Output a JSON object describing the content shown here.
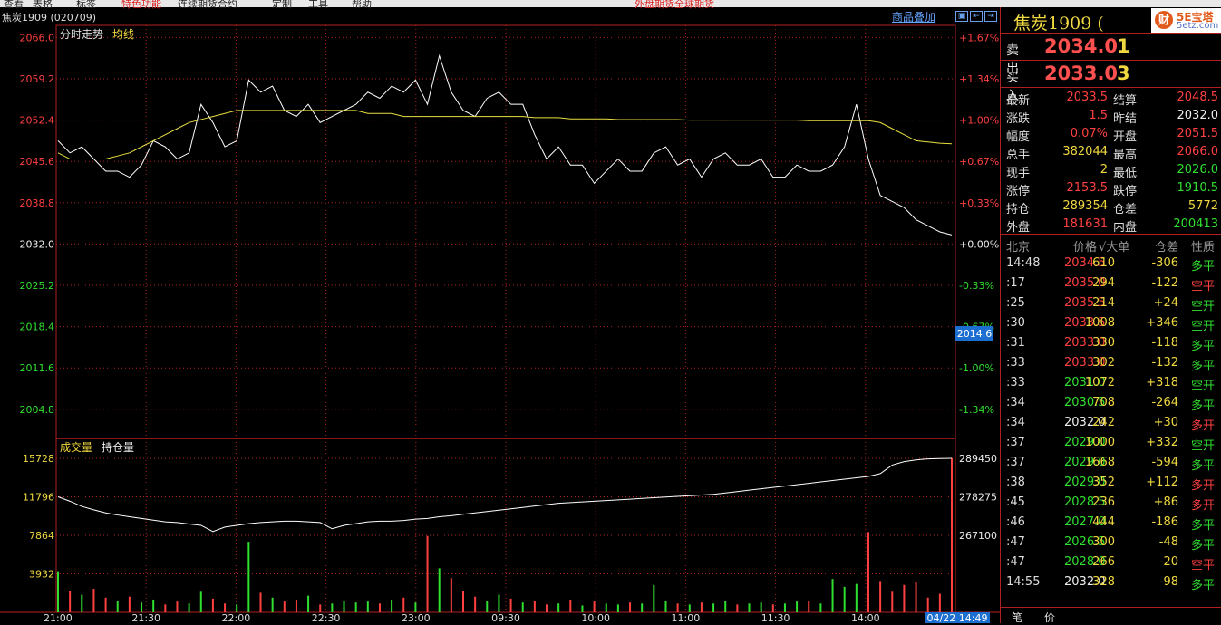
{
  "menu": {
    "items": [
      {
        "label": "查看",
        "color": "dark"
      },
      {
        "label": "表格",
        "color": "dark"
      },
      {
        "label": "标签",
        "color": "dark"
      },
      {
        "label": "特色功能",
        "color": "red"
      },
      {
        "label": "连续期货合约",
        "color": "dark"
      },
      {
        "label": "定制",
        "color": "dark"
      },
      {
        "label": "工具",
        "color": "dark"
      },
      {
        "label": "帮助",
        "color": "dark"
      },
      {
        "label": "外盘期货全球期货",
        "color": "red"
      }
    ]
  },
  "chart_header": {
    "symbol": "焦炭1909 (020709)",
    "overlay_link": "商品叠加",
    "nav_buttons": [
      "▣",
      "⇤",
      "⇥",
      "□"
    ]
  },
  "price_panel": {
    "title": "分时走势",
    "avg_label": "均线",
    "price_ticks": [
      "2066.0",
      "2059.2",
      "2052.4",
      "2045.6",
      "2038.8",
      "2032.0",
      "2025.2",
      "2018.4",
      "2011.6",
      "2004.8"
    ],
    "pct_ticks": [
      "+1.67%",
      "+1.34%",
      "+1.00%",
      "+0.67%",
      "+0.33%",
      "+0.00%",
      "-0.33%",
      "-0.67%",
      "-1.00%",
      "-1.34%"
    ],
    "cursor_value": "2014.6"
  },
  "volume_panel": {
    "vol_label": "成交量",
    "oi_label": "持仓量",
    "vol_ticks": [
      "15728",
      "11796",
      "7864",
      "3932"
    ],
    "oi_ticks": [
      "289450",
      "278275",
      "267100"
    ]
  },
  "time_axis": {
    "labels": [
      "21:00",
      "21:30",
      "22:00",
      "22:30",
      "23:00",
      "09:30",
      "10:00",
      "11:00",
      "11:30",
      "14:00",
      "14:30"
    ],
    "cursor_time": "04/22 14:49"
  },
  "chart_data": {
    "type": "line",
    "ylim": [
      2000.0,
      2068.0
    ],
    "ref_price": 2032.0,
    "price": [
      2049,
      2047,
      2048,
      2046,
      2044,
      2044,
      2043,
      2045,
      2049,
      2048,
      2046,
      2047,
      2055,
      2052,
      2048,
      2049,
      2059,
      2057,
      2058,
      2054,
      2053,
      2055,
      2052,
      2053,
      2054,
      2055,
      2057,
      2056,
      2058,
      2057,
      2059,
      2055,
      2063,
      2057,
      2054,
      2053,
      2056,
      2057,
      2055,
      2055,
      2050,
      2046,
      2048,
      2045,
      2045,
      2042,
      2044,
      2046,
      2044,
      2044,
      2047,
      2048,
      2045,
      2046,
      2043,
      2046,
      2047,
      2045,
      2045,
      2046,
      2043,
      2043,
      2045,
      2044,
      2044,
      2045,
      2048,
      2055,
      2046,
      2040,
      2039,
      2038,
      2036,
      2035,
      2034,
      2033.5
    ],
    "avg": [
      2047,
      2046,
      2046,
      2046,
      2046,
      2046.5,
      2047,
      2048,
      2049,
      2050,
      2051,
      2052,
      2052.5,
      2053,
      2053.5,
      2054,
      2054,
      2054,
      2054,
      2054,
      2054,
      2054,
      2054,
      2054,
      2054,
      2054,
      2053.5,
      2053.5,
      2053.5,
      2053,
      2053,
      2053,
      2053,
      2053,
      2053,
      2053,
      2053,
      2053,
      2053,
      2053,
      2052.8,
      2052.8,
      2052.8,
      2052.6,
      2052.6,
      2052.6,
      2052.6,
      2052.5,
      2052.5,
      2052.5,
      2052.5,
      2052.5,
      2052.5,
      2052.4,
      2052.4,
      2052.4,
      2052.4,
      2052.4,
      2052.4,
      2052.4,
      2052.4,
      2052.4,
      2052.4,
      2052.3,
      2052.3,
      2052.3,
      2052.3,
      2052.3,
      2052.3,
      2052,
      2051,
      2050,
      2049,
      2048.8,
      2048.6,
      2048.5
    ],
    "oi": [
      278275,
      277000,
      275500,
      274500,
      273600,
      273000,
      272500,
      272000,
      271500,
      271000,
      270800,
      270400,
      270000,
      268200,
      269500,
      270000,
      270500,
      270800,
      271000,
      271200,
      271200,
      271000,
      270800,
      269000,
      270000,
      270500,
      271000,
      271200,
      271200,
      271400,
      271800,
      272000,
      272500,
      272800,
      273200,
      273600,
      274000,
      274400,
      274800,
      275200,
      275600,
      276000,
      276400,
      276600,
      276800,
      277000,
      277200,
      277400,
      277600,
      277800,
      278000,
      278200,
      278400,
      278600,
      278800,
      279000,
      279400,
      279800,
      280200,
      280600,
      281000,
      281400,
      281800,
      282200,
      282600,
      283000,
      283400,
      283800,
      284200,
      285000,
      287500,
      288500,
      289000,
      289300,
      289400,
      289450
    ],
    "volume": [
      4200,
      2200,
      1800,
      2400,
      1500,
      1200,
      1600,
      1000,
      1300,
      800,
      1100,
      900,
      2100,
      1400,
      900,
      800,
      7200,
      2000,
      1500,
      1100,
      1300,
      1700,
      800,
      900,
      1200,
      1000,
      1100,
      900,
      1300,
      1500,
      1000,
      7800,
      4500,
      3500,
      2200,
      1600,
      1200,
      1800,
      1400,
      1000,
      1200,
      800,
      900,
      1300,
      700,
      1100,
      900,
      800,
      1000,
      900,
      2800,
      1200,
      900,
      800,
      1000,
      900,
      1200,
      800,
      900,
      1000,
      800,
      900,
      1100,
      1200,
      900,
      3400,
      2600,
      2900,
      8200,
      3200,
      2100,
      2800,
      3100,
      1500,
      1900,
      15728
    ],
    "series": [
      {
        "name": "均线"
      },
      {
        "name": "成交量"
      },
      {
        "name": "持仓量"
      }
    ]
  },
  "quote": {
    "name": "焦炭1909 (",
    "logo_circle": "财",
    "logo_text": "5E宝塔",
    "logo_url": "5etz.com",
    "sell_label": "卖出",
    "sell_price": "2034.0",
    "sell_vol": "1",
    "buy_label": "买入",
    "buy_price": "2033.0",
    "buy_vol": "3",
    "stats": [
      {
        "l1": "最新",
        "v1": "2033.5",
        "c1": "red",
        "l2": "结算",
        "v2": "2048.5",
        "c2": "red"
      },
      {
        "l1": "涨跌",
        "v1": "1.5",
        "c1": "red",
        "l2": "昨结",
        "v2": "2032.0",
        "c2": "white"
      },
      {
        "l1": "幅度",
        "v1": "0.07%",
        "c1": "red",
        "l2": "开盘",
        "v2": "2051.5",
        "c2": "red"
      },
      {
        "l1": "总手",
        "v1": "382044",
        "c1": "yellow",
        "l2": "最高",
        "v2": "2066.0",
        "c2": "red"
      },
      {
        "l1": "现手",
        "v1": "2",
        "c1": "yellow",
        "l2": "最低",
        "v2": "2026.0",
        "c2": "green"
      },
      {
        "l1": "涨停",
        "v1": "2153.5",
        "c1": "red",
        "l2": "跌停",
        "v2": "1910.5",
        "c2": "green"
      },
      {
        "l1": "持仓",
        "v1": "289354",
        "c1": "yellow",
        "l2": "仓差",
        "v2": "5772",
        "c2": "yellow"
      },
      {
        "l1": "外盘",
        "v1": "181631",
        "c1": "red",
        "l2": "内盘",
        "v2": "200413",
        "c2": "green"
      }
    ]
  },
  "ticks": {
    "headers": [
      "北京",
      "价格",
      "√大单",
      "仓差",
      "性质"
    ],
    "rows": [
      {
        "time": "14:48",
        "price": "2034.5",
        "pc": "red",
        "vol": "610",
        "oi": "-306",
        "type": "多平",
        "tc": "green"
      },
      {
        "time": ":17",
        "price": "2035.0",
        "pc": "red",
        "vol": "294",
        "oi": "-122",
        "type": "空平",
        "tc": "red"
      },
      {
        "time": ":25",
        "price": "2035.5",
        "pc": "red",
        "vol": "214",
        "oi": "+24",
        "type": "空开",
        "tc": "green"
      },
      {
        "time": ":30",
        "price": "2033.5",
        "pc": "red",
        "vol": "1008",
        "oi": "+346",
        "type": "空开",
        "tc": "green"
      },
      {
        "time": ":31",
        "price": "2033.0",
        "pc": "red",
        "vol": "330",
        "oi": "-118",
        "type": "多平",
        "tc": "green"
      },
      {
        "time": ":33",
        "price": "2033.0",
        "pc": "red",
        "vol": "302",
        "oi": "-132",
        "type": "多平",
        "tc": "green"
      },
      {
        "time": ":33",
        "price": "2031.0",
        "pc": "green",
        "vol": "1072",
        "oi": "+318",
        "type": "空开",
        "tc": "green"
      },
      {
        "time": ":34",
        "price": "2030.5",
        "pc": "green",
        "vol": "708",
        "oi": "-264",
        "type": "多平",
        "tc": "green"
      },
      {
        "time": ":34",
        "price": "2032.0",
        "pc": "white",
        "vol": "242",
        "oi": "+30",
        "type": "多开",
        "tc": "red"
      },
      {
        "time": ":37",
        "price": "2029.0",
        "pc": "green",
        "vol": "1000",
        "oi": "+332",
        "type": "空开",
        "tc": "green"
      },
      {
        "time": ":37",
        "price": "2029.0",
        "pc": "green",
        "vol": "1668",
        "oi": "-594",
        "type": "多平",
        "tc": "green"
      },
      {
        "time": ":38",
        "price": "2029.0",
        "pc": "green",
        "vol": "352",
        "oi": "+112",
        "type": "多开",
        "tc": "red"
      },
      {
        "time": ":45",
        "price": "2028.5",
        "pc": "green",
        "vol": "236",
        "oi": "+86",
        "type": "多开",
        "tc": "red"
      },
      {
        "time": ":46",
        "price": "2027.0",
        "pc": "green",
        "vol": "444",
        "oi": "-186",
        "type": "多平",
        "tc": "green"
      },
      {
        "time": ":47",
        "price": "2026.5",
        "pc": "green",
        "vol": "300",
        "oi": "-48",
        "type": "多平",
        "tc": "green"
      },
      {
        "time": ":47",
        "price": "2028.0",
        "pc": "green",
        "vol": "266",
        "oi": "-20",
        "type": "空平",
        "tc": "red"
      },
      {
        "time": "14:55",
        "price": "2032.0",
        "pc": "white",
        "vol": "328",
        "oi": "-98",
        "type": "多平",
        "tc": "green"
      }
    ]
  },
  "bottom_tabs": [
    "笔",
    "价"
  ],
  "colors": {
    "up": "#ff4040",
    "down": "#30e030",
    "flat": "#eeeeee",
    "yellow": "#f0d840",
    "grid": "#b02020",
    "avg": "#e8e040"
  }
}
